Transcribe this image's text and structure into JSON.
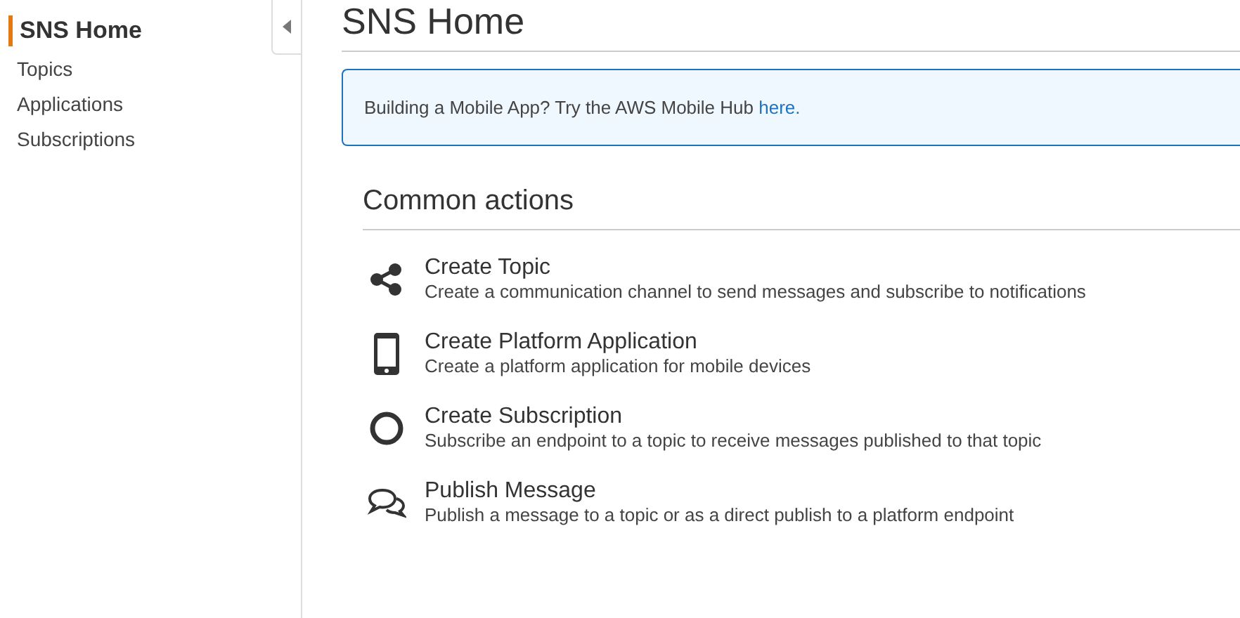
{
  "sidebar": {
    "items": [
      {
        "label": "SNS Home",
        "selected": true
      },
      {
        "label": "Topics",
        "selected": false
      },
      {
        "label": "Applications",
        "selected": false
      },
      {
        "label": "Subscriptions",
        "selected": false
      }
    ]
  },
  "page_title": "SNS Home",
  "banner": {
    "text": "Building a Mobile App? Try the AWS Mobile Hub",
    "link": "here."
  },
  "section_title": "Common actions",
  "actions": [
    {
      "kind": "share",
      "title": "Create Topic",
      "description": "Create a communication channel to send messages and subscribe to notifications"
    },
    {
      "kind": "mobile",
      "title": "Create Platform Application",
      "description": "Create a platform application for mobile devices"
    },
    {
      "kind": "circle",
      "title": "Create Subscription",
      "description": "Subscribe an endpoint to a topic to receive messages published to that topic"
    },
    {
      "kind": "chat",
      "title": "Publish Message",
      "description": "Publish a message to a topic or as a direct publish to a platform endpoint"
    }
  ]
}
